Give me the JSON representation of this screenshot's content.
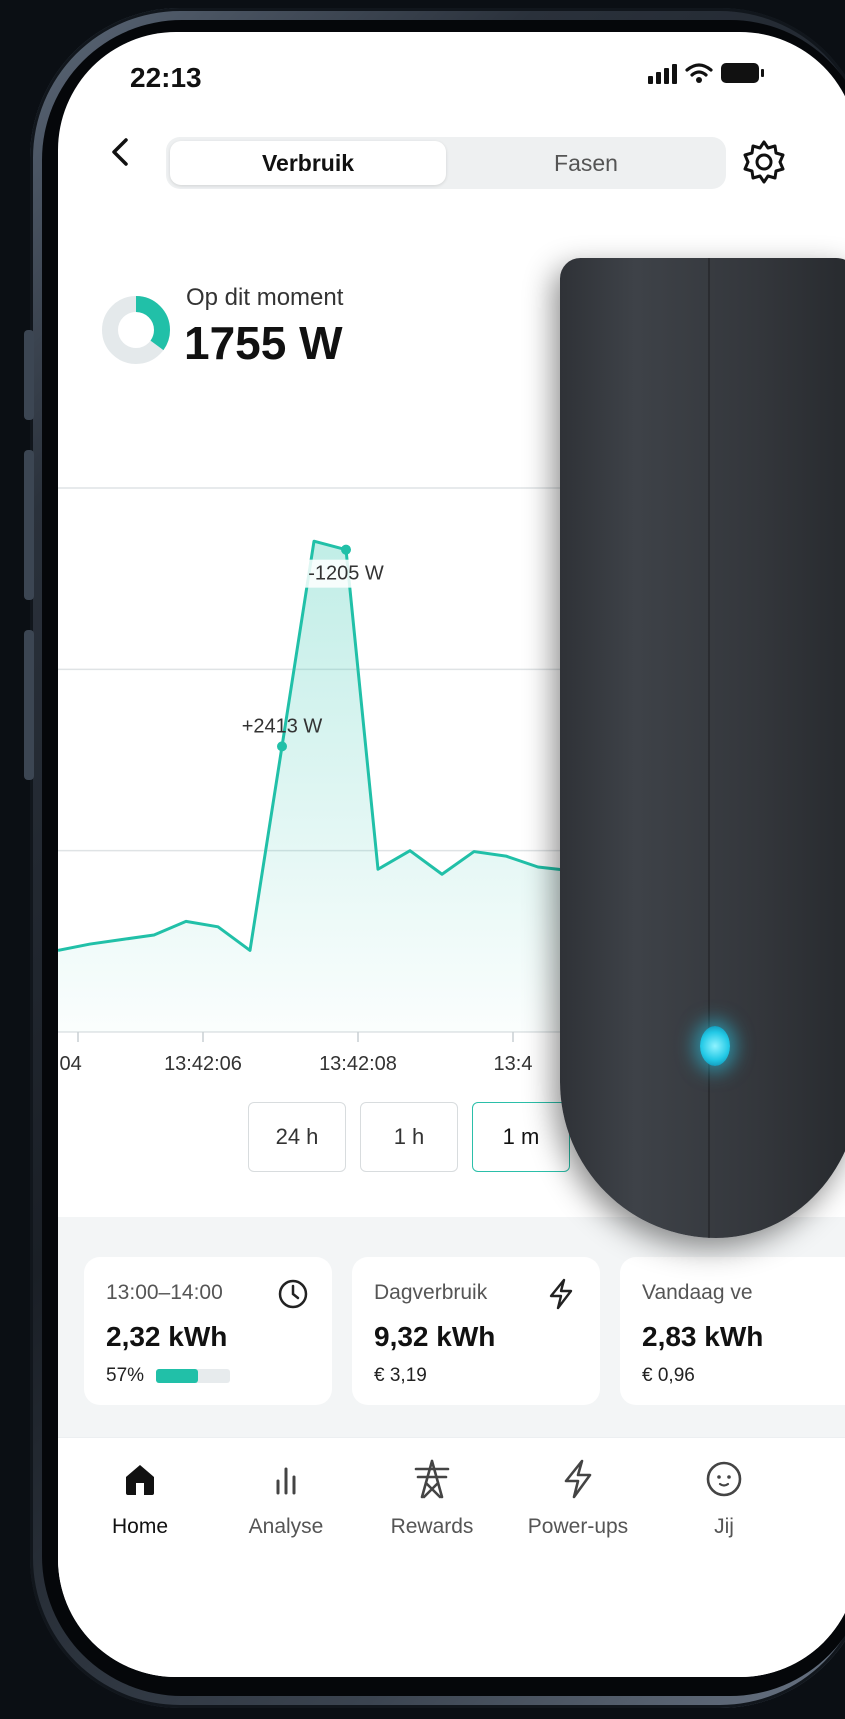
{
  "status": {
    "time": "22:13"
  },
  "header": {
    "segments": [
      "Verbruik",
      "Fasen"
    ],
    "active_segment": "Verbruik"
  },
  "current": {
    "label": "Op dit moment",
    "value": "1755 W",
    "ring_fraction": 0.35
  },
  "chart_data": {
    "type": "area",
    "x_ticks": [
      ":04",
      "13:42:06",
      "13:42:08",
      "13:4"
    ],
    "annotations": [
      {
        "text": "+2413 W",
        "point": 7
      },
      {
        "text": "-1205 W",
        "point": 9
      }
    ],
    "series": [
      {
        "values": [
          -2100,
          -2030,
          -1980,
          -1930,
          -1780,
          -1840,
          -2100,
          150,
          2413,
          2320,
          -1205,
          -1000,
          -1260,
          -1010,
          -1060,
          -1180,
          -1220
        ]
      }
    ],
    "ylim": [
      -3000,
      3000
    ],
    "line_color": "#21c0a8",
    "grid": true
  },
  "ranges": [
    "24 h",
    "1 h",
    "1 m"
  ],
  "active_range": "1 m",
  "cards": [
    {
      "title": "13:00–14:00",
      "value": "2,32 kWh",
      "sub": "57%",
      "progress": 0.57,
      "icon": "clock-icon"
    },
    {
      "title": "Dagverbruik",
      "value": "9,32 kWh",
      "sub": "€ 3,19",
      "icon": "bolt-icon"
    },
    {
      "title": "Vandaag ve",
      "value": "2,83 kWh",
      "sub": "€ 0,96"
    }
  ],
  "tabs": [
    {
      "label": "Home",
      "icon": "home-icon",
      "active": true
    },
    {
      "label": "Analyse",
      "icon": "analytics-icon"
    },
    {
      "label": "Rewards",
      "icon": "pylon-icon"
    },
    {
      "label": "Power-ups",
      "icon": "bolt-icon"
    },
    {
      "label": "Jij",
      "icon": "face-icon"
    }
  ],
  "colors": {
    "accent": "#21c0a8",
    "text": "#111111",
    "device": "#34373c",
    "led": "#23c9e6"
  }
}
